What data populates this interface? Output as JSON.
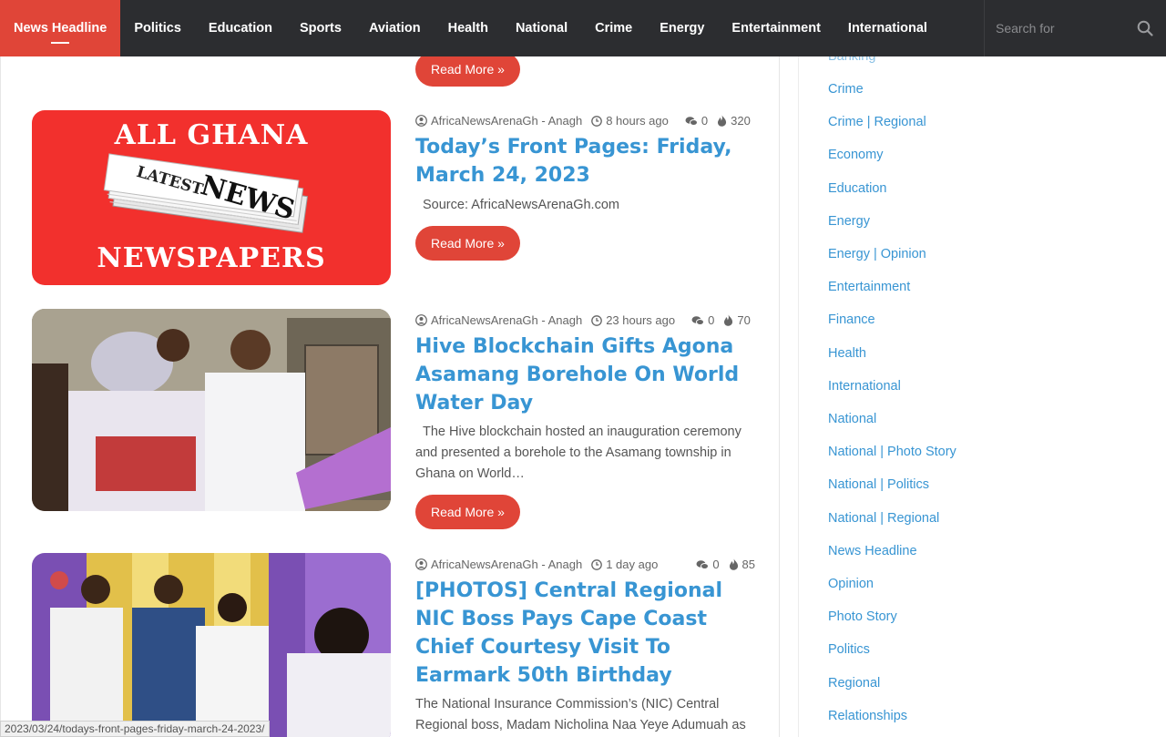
{
  "nav": {
    "items": [
      "News Headline",
      "Politics",
      "Education",
      "Sports",
      "Aviation",
      "Health",
      "National",
      "Crime",
      "Energy",
      "Entertainment",
      "International"
    ],
    "active_index": 0,
    "search_placeholder": "Search for"
  },
  "read_more_label": "Read More »",
  "posts": [
    {
      "author": "AfricaNewsArenaGh - Anagh",
      "time": "8 hours ago",
      "comments": "0",
      "views": "320",
      "title": "Today’s Front Pages: Friday, March 24, 2023",
      "excerpt": "Source: AfricaNewsArenaGh.com",
      "image_text_top": "ALL GHANA",
      "image_text_bottom": "NEWSPAPERS",
      "image_text_paper": "LATEST NEWS"
    },
    {
      "author": "AfricaNewsArenaGh - Anagh",
      "time": "23 hours ago",
      "comments": "0",
      "views": "70",
      "title": "Hive Blockchain Gifts Agona Asamang Borehole On World Water Day",
      "excerpt": "The Hive blockchain hosted an inauguration ceremony and presented a borehole to the Asamang township in Ghana on World…"
    },
    {
      "author": "AfricaNewsArenaGh - Anagh",
      "time": "1 day ago",
      "comments": "0",
      "views": "85",
      "title": "[PHOTOS] Central Regional NIC Boss Pays Cape Coast Chief Courtesy Visit To Earmark 50th Birthday",
      "excerpt": "The National Insurance Commission’s (NIC) Central Regional boss, Madam Nicholina Naa Yeye Adumuah as"
    }
  ],
  "sidebar": {
    "partial_top": "Banking",
    "categories": [
      "Crime",
      "Crime | Regional",
      "Economy",
      "Education",
      "Energy",
      "Energy | Opinion",
      "Entertainment",
      "Finance",
      "Health",
      "International",
      "National",
      "National | Photo Story",
      "National | Politics",
      "National | Regional",
      "News Headline",
      "Opinion",
      "Photo Story",
      "Politics",
      "Regional",
      "Relationships"
    ]
  },
  "status_url": "2023/03/24/todays-front-pages-friday-march-24-2023/"
}
